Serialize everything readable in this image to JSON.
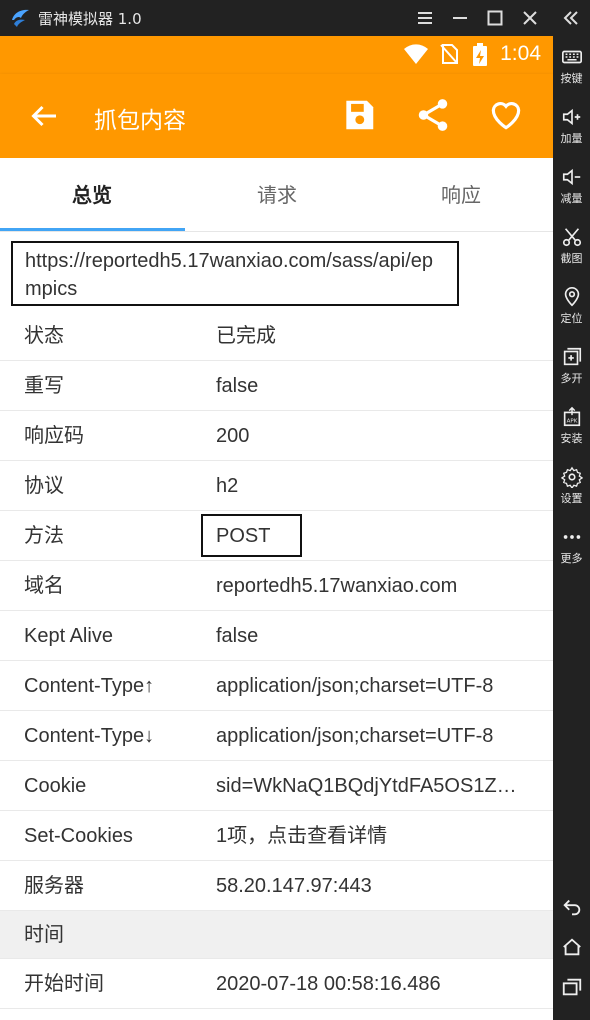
{
  "emulator": {
    "title": "雷神模拟器 1.0",
    "side_panel": [
      {
        "icon": "keyboard-icon",
        "label": "按键"
      },
      {
        "icon": "volume-up-icon",
        "label": "加量"
      },
      {
        "icon": "volume-down-icon",
        "label": "减量"
      },
      {
        "icon": "scissors-icon",
        "label": "截图"
      },
      {
        "icon": "location-pin-icon",
        "label": "定位"
      },
      {
        "icon": "multi-window-icon",
        "label": "多开"
      },
      {
        "icon": "apk-install-icon",
        "label": "安装"
      },
      {
        "icon": "gear-icon",
        "label": "设置"
      },
      {
        "icon": "more-dots-icon",
        "label": "更多"
      }
    ]
  },
  "status_bar": {
    "time": "1:04"
  },
  "app_bar": {
    "title": "抓包内容"
  },
  "tabs": [
    {
      "label": "总览",
      "active": true
    },
    {
      "label": "请求",
      "active": false
    },
    {
      "label": "响应",
      "active": false
    }
  ],
  "url": "https://reportedh5.17wanxiao.com/sass/api/epmpics",
  "rows": [
    {
      "key": "状态",
      "value": "已完成"
    },
    {
      "key": "重写",
      "value": "false"
    },
    {
      "key": "响应码",
      "value": "200"
    },
    {
      "key": "协议",
      "value": "h2"
    },
    {
      "key": "方法",
      "value": "POST"
    },
    {
      "key": "域名",
      "value": "reportedh5.17wanxiao.com"
    },
    {
      "key": "Kept Alive",
      "value": "false"
    },
    {
      "key": "Content-Type↑",
      "value": "application/json;charset=UTF-8"
    },
    {
      "key": "Content-Type↓",
      "value": "application/json;charset=UTF-8"
    },
    {
      "key": "Cookie",
      "value": "sid=WkNaQ1BQdjYtdFA5OS1Z…"
    },
    {
      "key": "Set-Cookies",
      "value": "1项，点击查看详情"
    },
    {
      "key": "服务器",
      "value": "58.20.147.97:443"
    }
  ],
  "section_time": {
    "label": "时间"
  },
  "time_rows": [
    {
      "key": "开始时间",
      "value": "2020-07-18 00:58:16.486"
    }
  ],
  "colors": {
    "accent": "#FF9800",
    "tab_indicator": "#42A5F5",
    "emulator_chrome": "#222222"
  }
}
